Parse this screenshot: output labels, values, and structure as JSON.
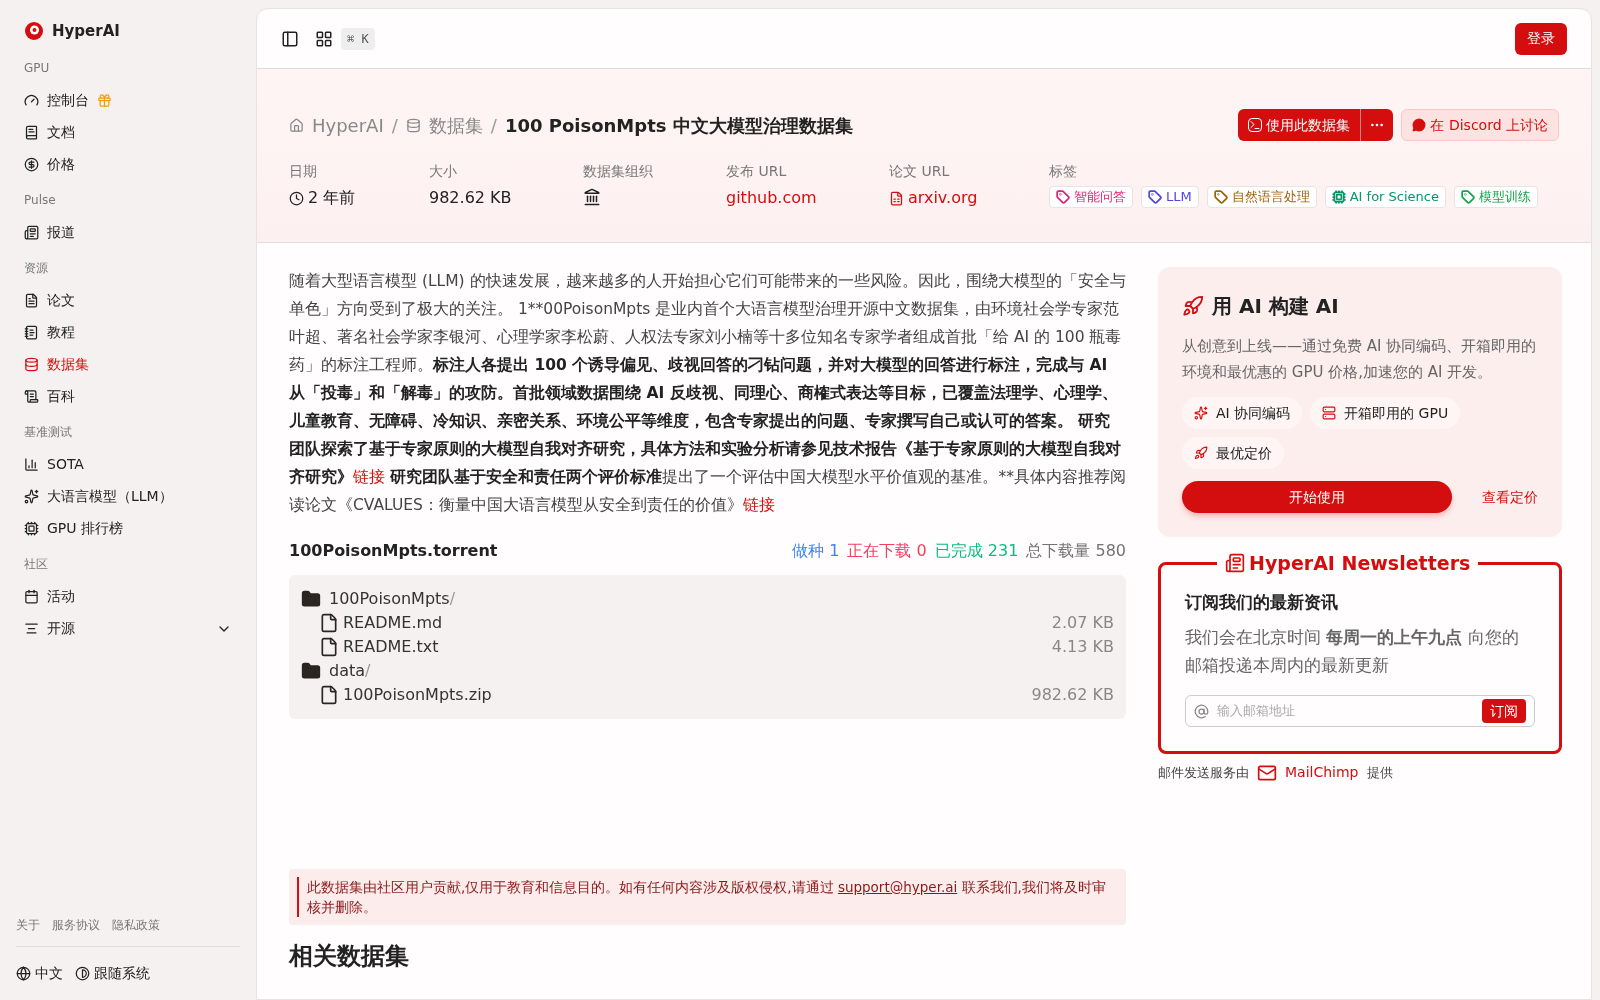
{
  "sidebar": {
    "brand": "HyperAI",
    "sections": [
      {
        "title": "GPU",
        "items": [
          {
            "label": "控制台",
            "selected": false,
            "kind": "gift"
          },
          {
            "label": "文档",
            "selected": false,
            "kind": "link"
          },
          {
            "label": "价格",
            "selected": false,
            "kind": "link"
          }
        ]
      },
      {
        "title": "Pulse",
        "items": [
          {
            "label": "报道",
            "selected": false,
            "kind": "link"
          }
        ]
      },
      {
        "title": "资源",
        "items": [
          {
            "label": "论文",
            "selected": false,
            "kind": "link"
          },
          {
            "label": "教程",
            "selected": false,
            "kind": "link"
          },
          {
            "label": "数据集",
            "selected": true,
            "kind": "link"
          },
          {
            "label": "百科",
            "selected": false,
            "kind": "link"
          }
        ]
      },
      {
        "title": "基准测试",
        "items": [
          {
            "label": "SOTA",
            "selected": false,
            "kind": "link"
          },
          {
            "label": "大语言模型（LLM）",
            "selected": false,
            "kind": "link"
          },
          {
            "label": "GPU 排行榜",
            "selected": false,
            "kind": "link"
          }
        ]
      },
      {
        "title": "社区",
        "items": [
          {
            "label": "活动",
            "selected": false,
            "kind": "link"
          },
          {
            "label": "开源",
            "selected": false,
            "kind": "group",
            "expanded": false
          }
        ]
      }
    ],
    "footer_links": [
      "关于",
      "服务协议",
      "隐私政策"
    ],
    "language": "中文",
    "theme": "跟随系统"
  },
  "topbar": {
    "shortcut": "⌘ K",
    "login": "登录"
  },
  "header": {
    "breadcrumb": [
      "HyperAI",
      "数据集"
    ],
    "separator": "/",
    "title": "100 PoisonMpts 中文大模型治理数据集",
    "use_button": "使用此数据集",
    "discord_button": "在 Discord 上讨论",
    "meta": [
      {
        "label": "日期",
        "value": "2 年前",
        "kind": "date"
      },
      {
        "label": "大小",
        "value": "982.62 KB",
        "kind": "text"
      },
      {
        "label": "数据集组织",
        "kind": "org"
      },
      {
        "label": "发布 URL",
        "value": "github.com",
        "kind": "link"
      },
      {
        "label": "论文 URL",
        "value": "arxiv.org",
        "kind": "paper"
      }
    ],
    "tags_label": "标签",
    "tags": [
      {
        "label": "智能问答",
        "color": "#db2777",
        "kind": "tag"
      },
      {
        "label": "LLM",
        "color": "#4f46e5",
        "kind": "tag"
      },
      {
        "label": "自然语言处理",
        "color": "#a16207",
        "kind": "tag"
      },
      {
        "label": "AI for Science",
        "color": "#059669",
        "kind": "chip"
      },
      {
        "label": "模型训练",
        "color": "#16a34a",
        "kind": "tag"
      }
    ]
  },
  "description": [
    {
      "kind": "text",
      "bold": false,
      "text": "随着大型语言模型 (LLM) 的快速发展，越来越多的人开始担心它们可能带来的一些风险。因此，围绕大模型的「安全与单色」方向受到了极大的关注。 1**00PoisonMpts 是业内首个大语言模型治理开源中文数据集，由环境社会学专家范叶超、著名社会学家李银河、心理学家李松蔚、人权法专家刘小楠等十多位知名专家学者组成首批「给 AI 的 100 瓶毒药」的标注工程师。"
    },
    {
      "kind": "text",
      "bold": true,
      "text": "标注人各提出 100 个诱导偏见、歧视回答的刁钻问题，并对大模型的回答进行标注，完成与 AI 从「投毒」和「解毒」的攻防。首批领域数据围绕 AI 反歧视、同理心、商榷式表达等目标，已覆盖法理学、心理学、儿童教育、无障碍、冷知识、亲密关系、环境公平等维度，包含专家提出的问题、专家撰写自己或认可的答案。 研究团队探索了基于专家原则的大模型自我对齐研究，具体方法和实验分析请参见技术报告《基于专家原则的大模型自我对齐研究》"
    },
    {
      "kind": "link",
      "text": "链接"
    },
    {
      "kind": "text",
      "bold": true,
      "text": " 研究团队基于安全和责任两个评价标准"
    },
    {
      "kind": "text",
      "bold": false,
      "text": "提出了一个评估中国大模型水平价值观的基准。**具体内容推荐阅读论文《CVALUES：衡量中国大语言模型从安全到责任的价值》"
    },
    {
      "kind": "link",
      "text": "链接"
    }
  ],
  "torrent": {
    "name": "100PoisonMpts.torrent",
    "stats": [
      {
        "text": "做种 1",
        "color": "#3b82f6"
      },
      {
        "text": "正在下载 0",
        "color": "#f43f5e"
      },
      {
        "text": "已完成 231",
        "color": "#10b981"
      },
      {
        "text": "总下载量 580",
        "color": "#737373"
      }
    ],
    "files": [
      {
        "name": "100PoisonMpts",
        "suffix": "/",
        "kind": "folder",
        "children": [
          {
            "name": "README.md",
            "size": "2.07 KB",
            "kind": "file"
          },
          {
            "name": "README.txt",
            "size": "4.13 KB",
            "kind": "file"
          }
        ]
      },
      {
        "name": "data",
        "suffix": "/",
        "kind": "folder",
        "children": [
          {
            "name": "100PoisonMpts.zip",
            "size": "982.62 KB",
            "kind": "file"
          }
        ]
      }
    ]
  },
  "disclaimer": {
    "before": "此数据集由社区用户贡献,仅用于教育和信息目的。如有任何内容涉及版权侵权,请通过 ",
    "link": "support@hyper.ai",
    "after": " 联系我们,我们将及时审核并删除。"
  },
  "related_heading": "相关数据集",
  "promo": {
    "title": "用 AI 构建 AI",
    "text": "从创意到上线——通过免费 AI 协同编码、开箱即用的环境和最优惠的 GPU 价格,加速您的 AI 开发。",
    "chips": [
      {
        "label": "AI 协同编码",
        "kind": "sparkle"
      },
      {
        "label": "开箱即用的 GPU",
        "kind": "server"
      },
      {
        "label": "最优定价",
        "kind": "rocket"
      }
    ],
    "start": "开始使用",
    "pricing": "查看定价"
  },
  "newsletter": {
    "legend": "HyperAI Newsletters",
    "title": "订阅我们的最新资讯",
    "text": "我们会在北京时间 **每周一的上午九点** 向您的邮箱投递本周内的最新更新",
    "placeholder": "输入邮箱地址",
    "button": "订阅"
  },
  "mail_credit": {
    "before": "邮件发送服务由",
    "brand": "MailChimp",
    "after": "提供"
  }
}
